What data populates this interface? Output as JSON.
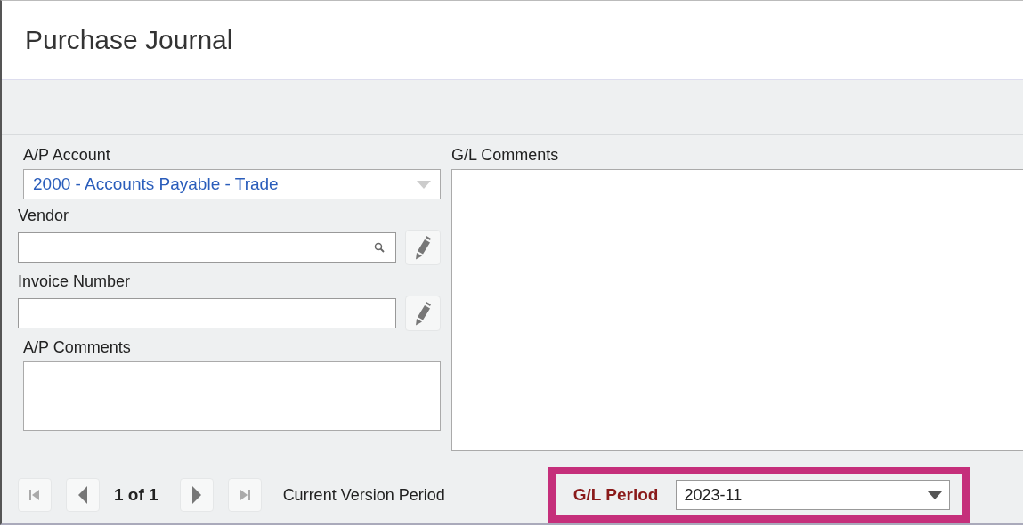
{
  "window": {
    "title": "Purchase Journal"
  },
  "form": {
    "ap_account": {
      "label": "A/P Account",
      "value": "2000 - Accounts Payable - Trade"
    },
    "vendor": {
      "label": "Vendor"
    },
    "invoice_number": {
      "label": "Invoice Number"
    },
    "ap_comments": {
      "label": "A/P Comments"
    },
    "gl_comments": {
      "label": "G/L Comments"
    }
  },
  "footer": {
    "nav_buttons": [
      {
        "kind": "first",
        "disabled": true
      },
      {
        "kind": "prev",
        "disabled": false
      },
      {
        "kind": "next",
        "disabled": false
      },
      {
        "kind": "last",
        "disabled": true
      }
    ],
    "page_info": "1 of 1",
    "version_label": "Current Version Period",
    "gl_period": {
      "label": "G/L Period",
      "value": "2023-11",
      "highlighted": true
    }
  }
}
